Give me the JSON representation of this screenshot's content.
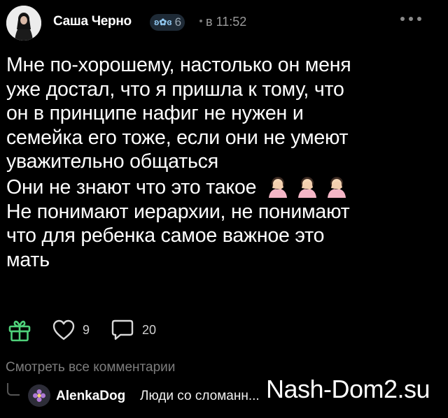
{
  "post": {
    "author": "Саша Черно",
    "level": "6",
    "time": "в 11:52",
    "text_lines": [
      "Мне по-хорошему, настолько он меня",
      "уже достал, что я пришла к тому, что",
      "он в принципе нафиг не нужен и",
      "семейка его тоже, если они не умеют",
      "уважительно общаться",
      "Они не знают что это такое",
      "Не понимают иерархии, не понимают",
      "что для ребенка самое важное это",
      "мать"
    ],
    "emoji": [
      "facepalm-woman",
      "facepalm-woman",
      "facepalm-woman"
    ]
  },
  "actions": {
    "likes": "9",
    "comments": "20"
  },
  "comments": {
    "view_all": "Смотреть все комментарии",
    "preview": {
      "author": "AlenkaDog",
      "text": "Люди со сломанн..."
    }
  },
  "watermark": "Nash-Dom2.su",
  "colors": {
    "background": "#000000",
    "text": "#ffffff",
    "muted": "#9a9a9a",
    "badge_bg": "#1e2a36",
    "badge_wing": "#8fc6ef"
  }
}
